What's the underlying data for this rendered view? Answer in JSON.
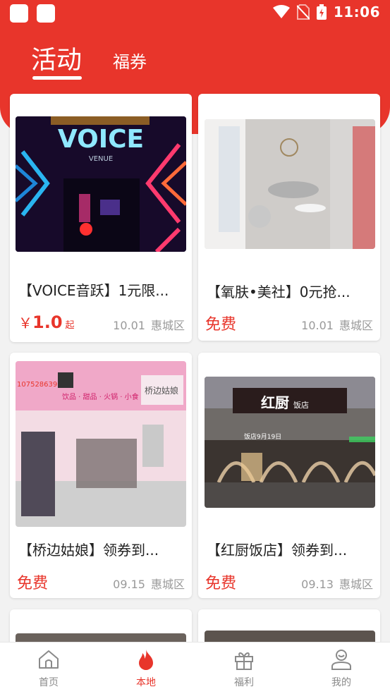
{
  "status_bar": {
    "time": "11:06"
  },
  "tabs": {
    "active_label": "活动",
    "other_label": "福券"
  },
  "cards": [
    {
      "title": "【VOICE音跃】1元限...",
      "price_currency": "￥",
      "price_amount": "1.0",
      "price_suffix": "起",
      "date": "10.01",
      "district": "惠城区",
      "image_text": "VOICE",
      "image_subtext": "VENUE"
    },
    {
      "title": "【氧肤•美社】0元抢...",
      "price_label": "免费",
      "date": "10.01",
      "district": "惠城区"
    },
    {
      "title": "【桥边姑娘】领券到...",
      "price_label": "免费",
      "date": "09.15",
      "district": "惠城区",
      "image_phone": "107528639",
      "image_sign_text": "饮品 · 甜品 · 火锅 · 小食",
      "image_logo_text": "桥边姑娘"
    },
    {
      "title": "【红厨饭店】领券到...",
      "price_label": "免费",
      "date": "09.13",
      "district": "惠城区",
      "image_sign_text": "红厨",
      "image_sign_sub": "饭店",
      "image_small_text": "饭店9月19日"
    }
  ],
  "bottom_nav": [
    {
      "label": "首页",
      "icon": "home-icon"
    },
    {
      "label": "本地",
      "icon": "flame-icon"
    },
    {
      "label": "福利",
      "icon": "gift-icon"
    },
    {
      "label": "我的",
      "icon": "user-icon"
    }
  ],
  "colors": {
    "accent": "#e8352b",
    "nav_inactive": "#8a8a8a",
    "meta_gray": "#999999"
  }
}
